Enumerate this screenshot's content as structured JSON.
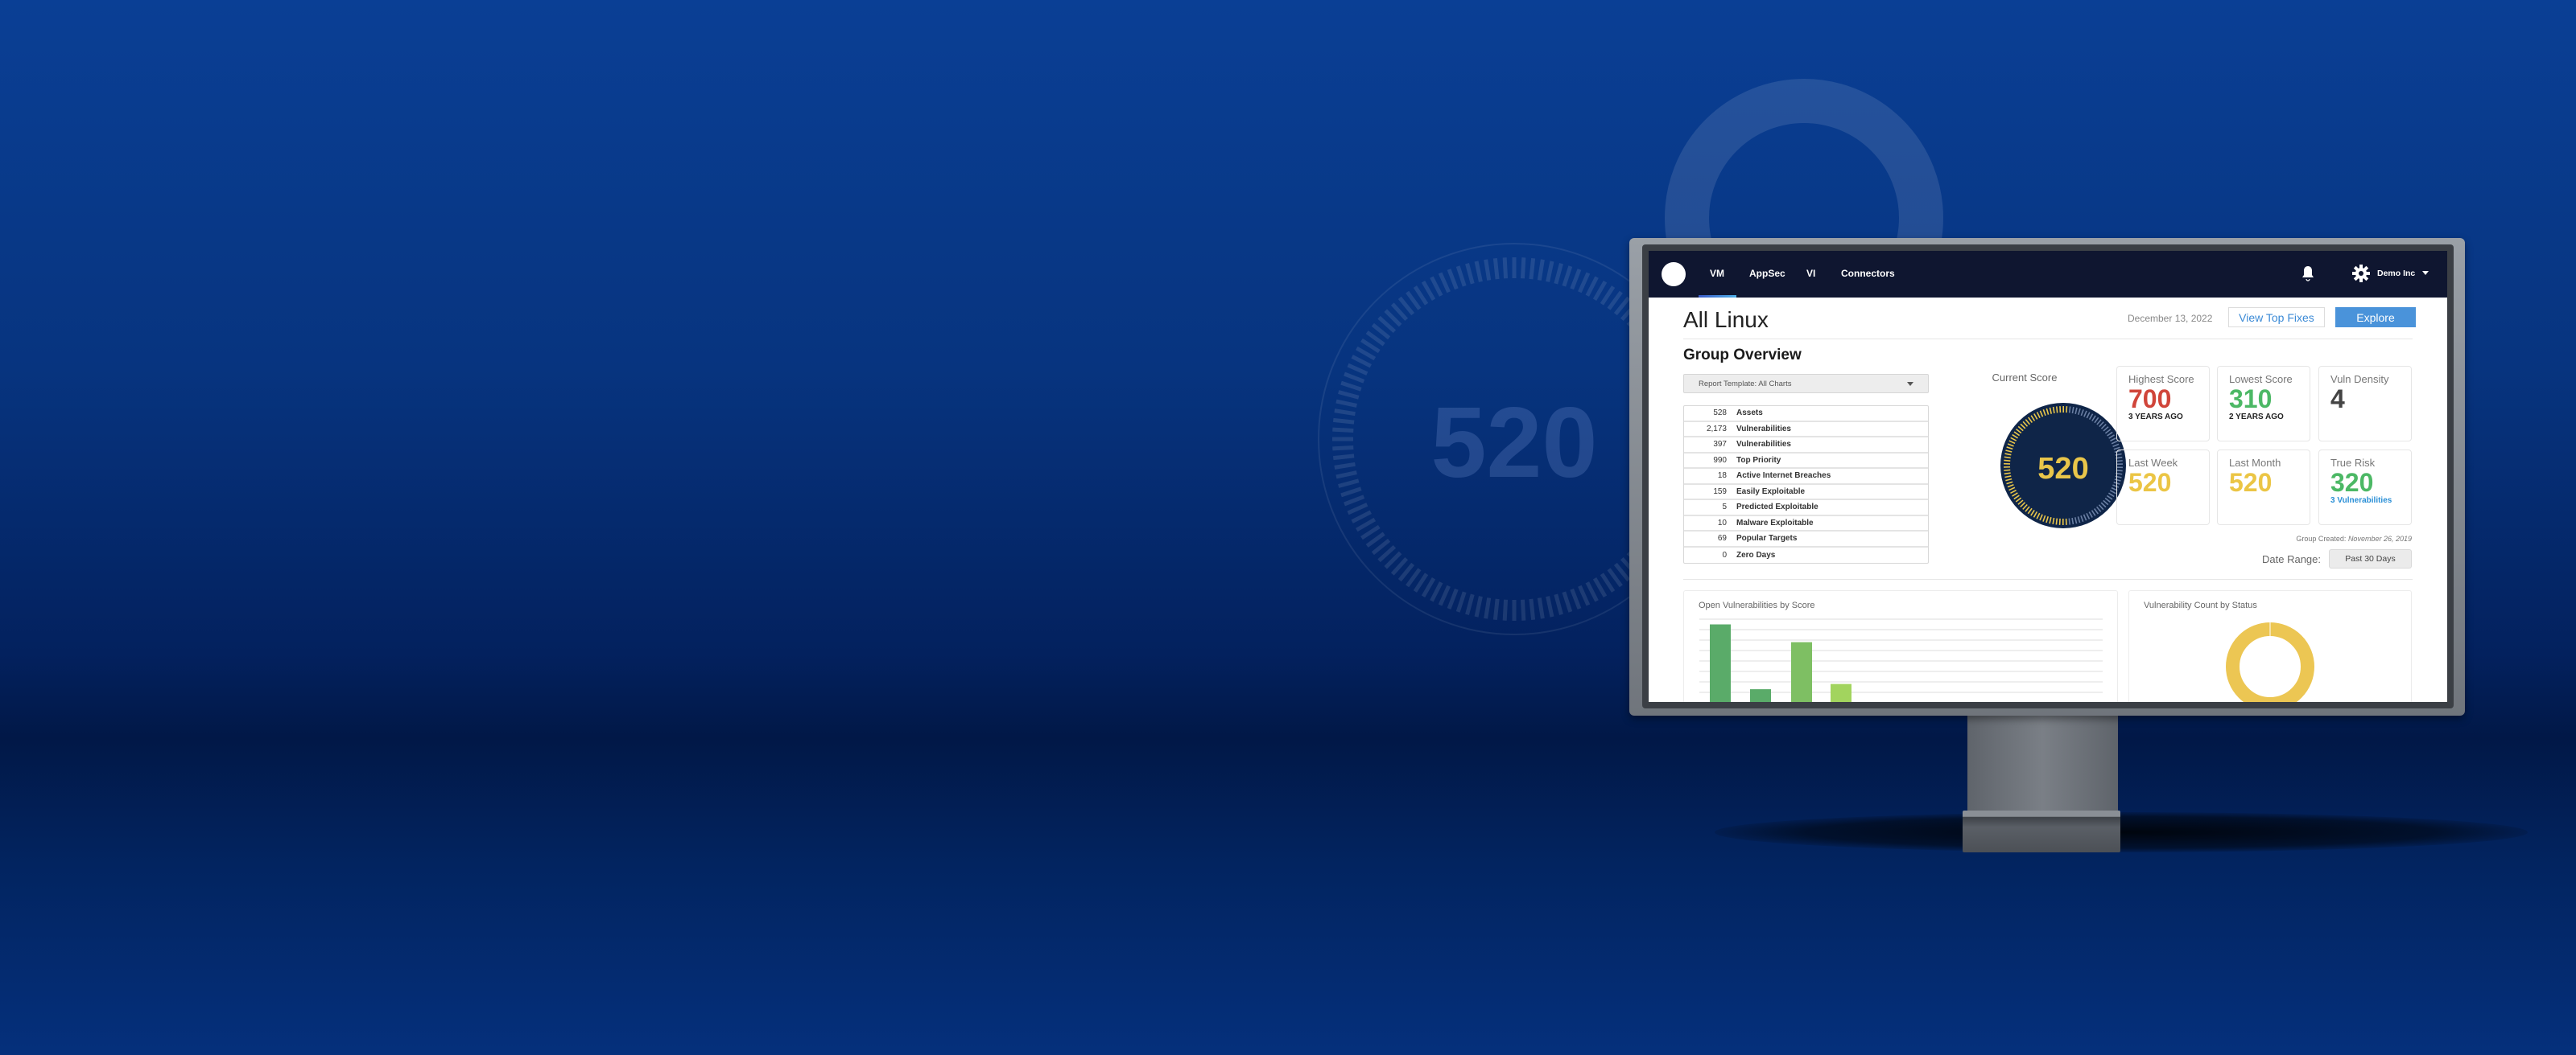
{
  "background": {
    "score": "520"
  },
  "nav": {
    "tabs": [
      {
        "label": "VM",
        "active": true
      },
      {
        "label": "AppSec"
      },
      {
        "label": "VI"
      },
      {
        "label": "Connectors"
      }
    ],
    "account": "Demo Inc",
    "icons": [
      "logo",
      "bell-icon",
      "gear-icon",
      "chevron-down-icon"
    ]
  },
  "header": {
    "title": "All Linux",
    "date": "December 13, 2022",
    "view_top_fixes": "View Top Fixes",
    "explore": "Explore"
  },
  "overview": {
    "heading": "Group Overview",
    "template_select": "Report Template: All Charts",
    "rows": [
      {
        "count": "528",
        "label": "Assets"
      },
      {
        "count": "2,173",
        "label": "Vulnerabilities"
      },
      {
        "count": "397",
        "label": "Vulnerabilities"
      },
      {
        "count": "990",
        "label": "Top Priority"
      },
      {
        "count": "18",
        "label": "Active Internet Breaches"
      },
      {
        "count": "159",
        "label": "Easily Exploitable"
      },
      {
        "count": "5",
        "label": "Predicted Exploitable"
      },
      {
        "count": "10",
        "label": "Malware Exploitable"
      },
      {
        "count": "69",
        "label": "Popular Targets"
      },
      {
        "count": "0",
        "label": "Zero Days"
      }
    ]
  },
  "current_score": {
    "label": "Current Score",
    "value": "520",
    "gauge_fill": 0.52,
    "fill_color": "#e9c64a",
    "track_color": "#6a7fa3",
    "face_color": "#0f2548"
  },
  "cards": [
    {
      "label": "Highest Score",
      "value": "700",
      "sub": "3 YEARS AGO",
      "color": "#d0453a",
      "sub_color": "#222"
    },
    {
      "label": "Lowest Score",
      "value": "310",
      "sub": "2 YEARS AGO",
      "color": "#4cb865",
      "sub_color": "#222"
    },
    {
      "label": "Vuln Density",
      "value": "4",
      "sub": "",
      "color": "#444",
      "sub_color": "#222"
    },
    {
      "label": "Last Week",
      "value": "520",
      "sub": "",
      "color": "#ebc545",
      "sub_color": "#222"
    },
    {
      "label": "Last Month",
      "value": "520",
      "sub": "",
      "color": "#ebc545",
      "sub_color": "#222"
    },
    {
      "label": "True Risk",
      "value": "320",
      "sub": "3 Vulnerabilities",
      "color": "#4cb865",
      "sub_color": "#2a8fd6"
    }
  ],
  "group_created": {
    "label": "Group Created:",
    "date": "November 26, 2019"
  },
  "date_range": {
    "label": "Date Range:",
    "value": "Past 30 Days"
  },
  "panels": {
    "bar_title": "Open Vulnerabilities by Score",
    "donut_title": "Vulnerability Count by Status"
  },
  "chart_data": [
    {
      "type": "bar",
      "title": "Open Vulnerabilities by Score",
      "values": [
        7.5,
        1.3,
        5.8,
        1.8
      ],
      "colors": [
        "#5aab69",
        "#5aab69",
        "#7ebf63",
        "#a2d45e"
      ],
      "grid": true
    },
    {
      "type": "pie",
      "title": "Vulnerability Count by Status",
      "values": [
        1
      ],
      "colors": [
        "#ecc653"
      ]
    }
  ]
}
